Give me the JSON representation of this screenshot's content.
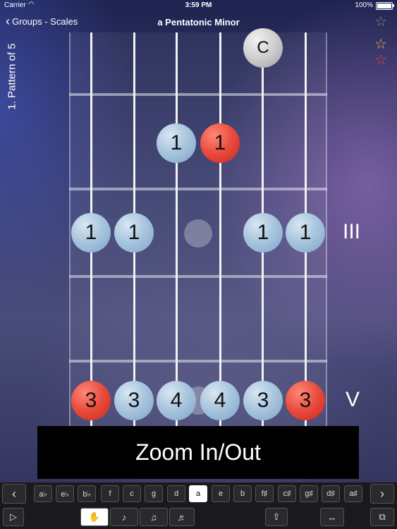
{
  "status_bar": {
    "carrier": "Carrier",
    "time": "3:59 PM",
    "battery": "100%"
  },
  "nav": {
    "back_label": "Groups - Scales",
    "title": "a Pentatonic Minor"
  },
  "pattern_label": "1. Pattern of 5",
  "fret_markers": [
    "III",
    "V"
  ],
  "notes": {
    "top_c": "C",
    "row2": [
      "1",
      "1"
    ],
    "row3": [
      "1",
      "1",
      "1",
      "1"
    ],
    "row5": [
      "3",
      "3",
      "4",
      "4",
      "3",
      "3"
    ]
  },
  "zoom_label": "Zoom In/Out",
  "keys": [
    "a♭",
    "e♭",
    "b♭",
    "f",
    "c",
    "g",
    "d",
    "a",
    "e",
    "b",
    "f♯",
    "c♯",
    "g♯",
    "d♯",
    "a♯"
  ],
  "selected_key": "a",
  "colors": {
    "root": "#e84a3c",
    "note": "#a9c6de",
    "accent_star": "#e0b84a"
  }
}
